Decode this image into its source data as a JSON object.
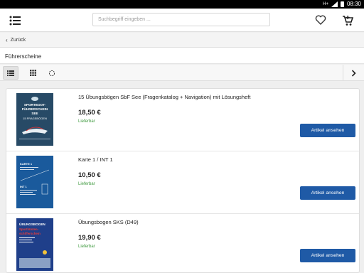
{
  "statusbar": {
    "network": "H+",
    "time": "08:30"
  },
  "appbar": {
    "search_placeholder": "Suchbegriff eingeben ..."
  },
  "nav": {
    "back_label": "Zurück"
  },
  "page": {
    "title": "Führerscheine"
  },
  "products": [
    {
      "title": "15 Übungsbögen SbF See (Fragenkatalog + Navigation) mit Lösungsheft",
      "price": "18,50 €",
      "availability": "Lieferbar",
      "button": "Artikel ansehen",
      "cover": {
        "line1": "SPORTBOOT-",
        "line2": "FÜHRERSCHEIN",
        "line3": "SEE",
        "line4": "15 FRAGEBÖGEN",
        "color": "#274a66"
      }
    },
    {
      "title": "Karte 1 / INT 1",
      "price": "10,50 €",
      "availability": "Lieferbar",
      "button": "Artikel ansehen",
      "cover": {
        "line1": "KARTE 1",
        "line2": "INT 1",
        "color": "#1a5a9c"
      }
    },
    {
      "title": "Übungsbogen SKS (D49)",
      "price": "19,90 €",
      "availability": "Lieferbar",
      "button": "Artikel ansehen",
      "cover": {
        "line1": "ÜBUNGSBOGEN",
        "line2": "Sportküsten-",
        "line3": "schifferschein",
        "color": "#1f3f8a"
      }
    }
  ],
  "colors": {
    "accent": "#1f5aa6",
    "available": "#3f9a3f"
  }
}
